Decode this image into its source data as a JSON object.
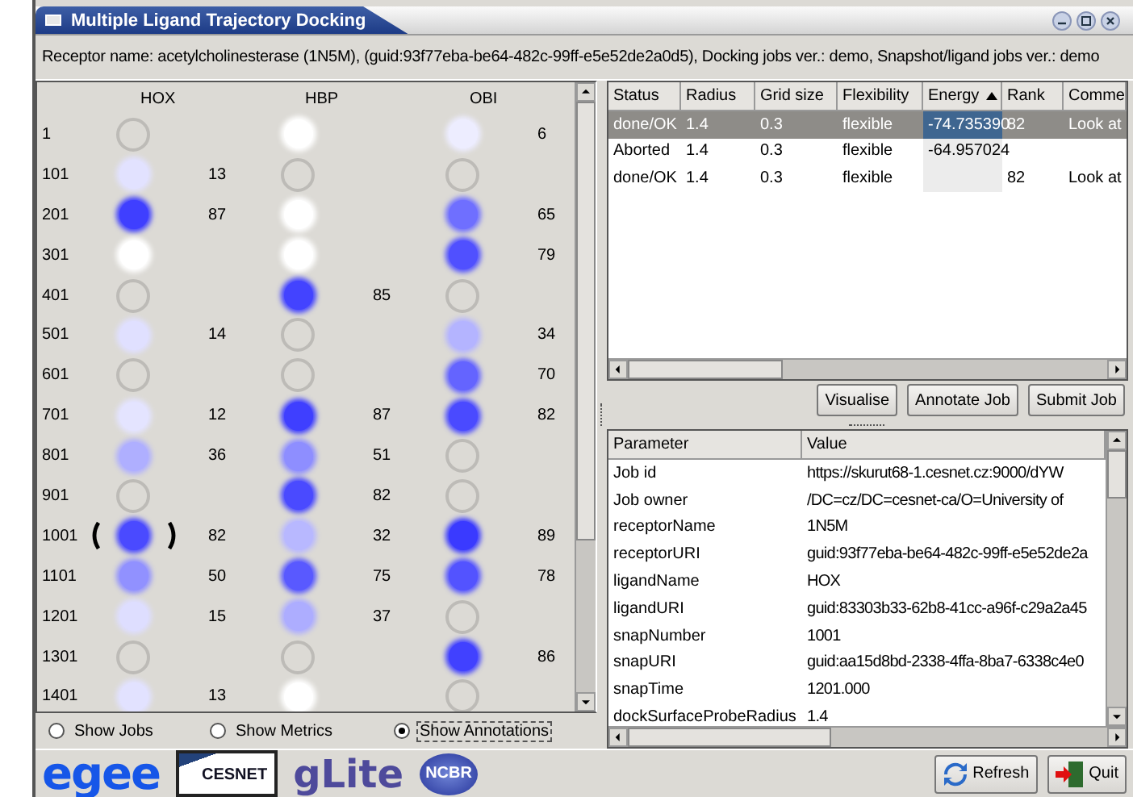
{
  "window": {
    "title": "Multiple Ligand Trajectory Docking"
  },
  "info_line": "Receptor name: acetylcholinesterase (1N5M), (guid:93f77eba-be64-482c-99ff-e5e52de2a0d5), Docking jobs ver.: demo, Snapshot/ligand jobs ver.: demo",
  "grid": {
    "ligands": [
      "HOX",
      "HBP",
      "OBI"
    ],
    "rows": [
      {
        "snapshot": "1",
        "cells": [
          {
            "kind": "empty",
            "selected": false
          },
          {
            "kind": "dot",
            "color": "#ffffff",
            "selected": false
          },
          {
            "kind": "dot",
            "color": "#ededff",
            "value": "6",
            "selected": false
          }
        ]
      },
      {
        "snapshot": "101",
        "cells": [
          {
            "kind": "dot",
            "color": "#e2e2ff",
            "value": "13",
            "selected": false
          },
          {
            "kind": "empty",
            "selected": false
          },
          {
            "kind": "empty",
            "selected": false
          }
        ]
      },
      {
        "snapshot": "201",
        "cells": [
          {
            "kind": "dot",
            "color": "#3f3fff",
            "value": "87",
            "selected": false
          },
          {
            "kind": "dot",
            "color": "#ffffff",
            "selected": false
          },
          {
            "kind": "dot",
            "color": "#6f6fff",
            "value": "65",
            "selected": false
          }
        ]
      },
      {
        "snapshot": "301",
        "cells": [
          {
            "kind": "dot",
            "color": "#ffffff",
            "selected": false
          },
          {
            "kind": "dot",
            "color": "#ffffff",
            "selected": false
          },
          {
            "kind": "dot",
            "color": "#5050ff",
            "value": "79",
            "selected": false
          }
        ]
      },
      {
        "snapshot": "401",
        "cells": [
          {
            "kind": "empty",
            "selected": false
          },
          {
            "kind": "dot",
            "color": "#4343ff",
            "value": "85",
            "selected": false
          },
          {
            "kind": "empty",
            "selected": false
          }
        ]
      },
      {
        "snapshot": "501",
        "cells": [
          {
            "kind": "dot",
            "color": "#e0e0ff",
            "value": "14",
            "selected": false
          },
          {
            "kind": "empty",
            "selected": false
          },
          {
            "kind": "dot",
            "color": "#b4b4ff",
            "value": "34",
            "selected": false
          }
        ]
      },
      {
        "snapshot": "601",
        "cells": [
          {
            "kind": "empty",
            "selected": false
          },
          {
            "kind": "empty",
            "selected": false
          },
          {
            "kind": "dot",
            "color": "#6464ff",
            "value": "70",
            "selected": false
          }
        ]
      },
      {
        "snapshot": "701",
        "cells": [
          {
            "kind": "dot",
            "color": "#e4e4ff",
            "value": "12",
            "selected": false
          },
          {
            "kind": "dot",
            "color": "#3f3fff",
            "value": "87",
            "selected": false
          },
          {
            "kind": "dot",
            "color": "#4a4aff",
            "value": "82",
            "selected": false
          }
        ]
      },
      {
        "snapshot": "801",
        "cells": [
          {
            "kind": "dot",
            "color": "#afafff",
            "value": "36",
            "selected": false
          },
          {
            "kind": "dot",
            "color": "#8e8eff",
            "value": "51",
            "selected": false
          },
          {
            "kind": "empty",
            "selected": false
          }
        ]
      },
      {
        "snapshot": "901",
        "cells": [
          {
            "kind": "empty",
            "selected": false
          },
          {
            "kind": "dot",
            "color": "#4a4aff",
            "value": "82",
            "selected": false
          },
          {
            "kind": "empty",
            "selected": false
          }
        ]
      },
      {
        "snapshot": "1001",
        "cells": [
          {
            "kind": "dot",
            "color": "#4a4aff",
            "value": "82",
            "selected": true
          },
          {
            "kind": "dot",
            "color": "#b8b8ff",
            "value": "32",
            "selected": false
          },
          {
            "kind": "dot",
            "color": "#3a3aff",
            "value": "89",
            "selected": false
          }
        ]
      },
      {
        "snapshot": "1101",
        "cells": [
          {
            "kind": "dot",
            "color": "#9191ff",
            "value": "50",
            "selected": false
          },
          {
            "kind": "dot",
            "color": "#5959ff",
            "value": "75",
            "selected": false
          },
          {
            "kind": "dot",
            "color": "#5353ff",
            "value": "78",
            "selected": false
          }
        ]
      },
      {
        "snapshot": "1201",
        "cells": [
          {
            "kind": "dot",
            "color": "#dedeff",
            "value": "15",
            "selected": false
          },
          {
            "kind": "dot",
            "color": "#adadff",
            "value": "37",
            "selected": false
          },
          {
            "kind": "empty",
            "selected": false
          }
        ]
      },
      {
        "snapshot": "1301",
        "cells": [
          {
            "kind": "empty",
            "selected": false
          },
          {
            "kind": "empty",
            "selected": false
          },
          {
            "kind": "dot",
            "color": "#4141ff",
            "value": "86",
            "selected": false
          }
        ]
      },
      {
        "snapshot": "1401",
        "cells": [
          {
            "kind": "dot",
            "color": "#e2e2ff",
            "value": "13",
            "selected": false
          },
          {
            "kind": "dot",
            "color": "#ffffff",
            "selected": false
          },
          {
            "kind": "empty",
            "selected": false
          }
        ]
      }
    ]
  },
  "view_options": [
    {
      "label": "Show Jobs",
      "selected": false
    },
    {
      "label": "Show Metrics",
      "selected": false
    },
    {
      "label": "Show Annotations",
      "selected": true
    }
  ],
  "jobs_table": {
    "columns": [
      {
        "label": "Status",
        "sorted": false
      },
      {
        "label": "Radius",
        "sorted": false
      },
      {
        "label": "Grid size",
        "sorted": false
      },
      {
        "label": "Flexibility",
        "sorted": false
      },
      {
        "label": "Energy",
        "sorted": true
      },
      {
        "label": "Rank",
        "sorted": false
      },
      {
        "label": "Comme",
        "sorted": false
      }
    ],
    "rows": [
      {
        "selected": true,
        "cells": [
          "done/OK",
          "1.4",
          "0.3",
          "flexible",
          "-74.735390",
          "82",
          "Look at"
        ]
      },
      {
        "selected": false,
        "cells": [
          "Aborted",
          "1.4",
          "0.3",
          "flexible",
          "-64.957024",
          "",
          ""
        ]
      },
      {
        "selected": false,
        "cells": [
          "done/OK",
          "1.4",
          "0.3",
          "flexible",
          "",
          "82",
          "Look at"
        ]
      }
    ]
  },
  "job_buttons": [
    "Visualise",
    "Annotate Job",
    "Submit Job"
  ],
  "parameters": {
    "columns": [
      "Parameter",
      "Value"
    ],
    "rows": [
      {
        "parameter": "Job id",
        "value": "https://skurut68-1.cesnet.cz:9000/dYW"
      },
      {
        "parameter": "Job owner",
        "value": "/DC=cz/DC=cesnet-ca/O=University of"
      },
      {
        "parameter": "receptorName",
        "value": "1N5M"
      },
      {
        "parameter": "receptorURI",
        "value": "guid:93f77eba-be64-482c-99ff-e5e52de2a"
      },
      {
        "parameter": "ligandName",
        "value": "HOX"
      },
      {
        "parameter": "ligandURI",
        "value": "guid:83303b33-62b8-41cc-a96f-c29a2a45"
      },
      {
        "parameter": "snapNumber",
        "value": "1001"
      },
      {
        "parameter": "snapURI",
        "value": "guid:aa15d8bd-2338-4ffa-8ba7-6338c4e0"
      },
      {
        "parameter": "snapTime",
        "value": "1201.000"
      },
      {
        "parameter": "dockSurfaceProbeRadius",
        "value": "1.4"
      }
    ]
  },
  "logos": [
    "egee",
    "CESNET",
    "gLite",
    "NCBR"
  ],
  "footer_buttons": [
    "Refresh",
    "Quit"
  ]
}
